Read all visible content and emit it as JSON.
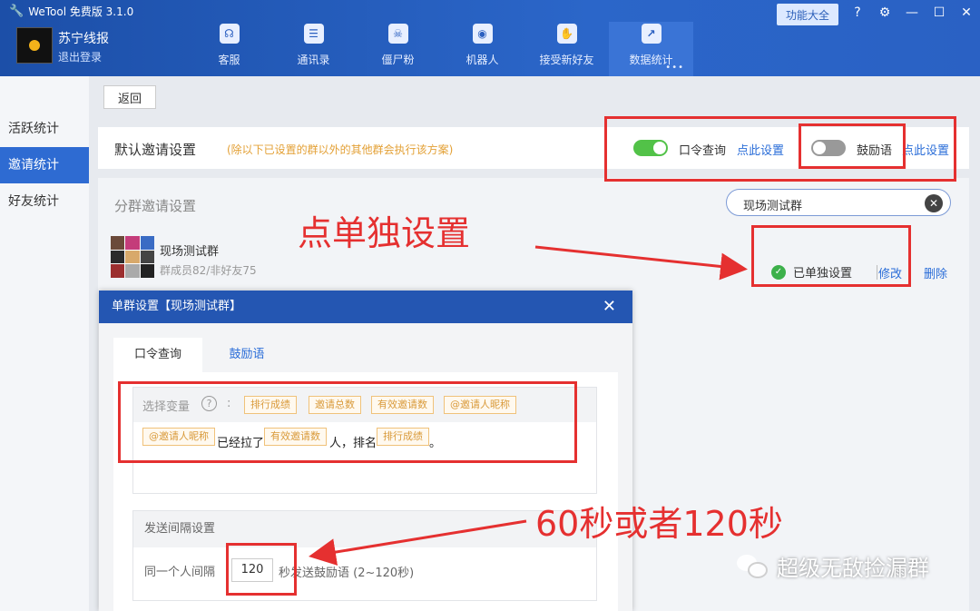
{
  "app": {
    "title": "WeTool 免费版 3.1.0",
    "account_name": "苏宁线报",
    "logout": "退出登录",
    "func_button": "功能大全"
  },
  "nav": [
    {
      "label": "客服",
      "icon": "headset-icon"
    },
    {
      "label": "通讯录",
      "icon": "contacts-icon"
    },
    {
      "label": "僵尸粉",
      "icon": "skull-icon"
    },
    {
      "label": "机器人",
      "icon": "robot-icon"
    },
    {
      "label": "接受新好友",
      "icon": "handshake-icon"
    },
    {
      "label": "数据统计",
      "icon": "chart-icon",
      "active": true
    }
  ],
  "sidebar": {
    "items": [
      {
        "label": "活跃统计"
      },
      {
        "label": "邀请统计",
        "active": true
      },
      {
        "label": "好友统计"
      }
    ]
  },
  "main": {
    "back": "返回",
    "default_panel": {
      "title": "默认邀请设置",
      "hint": "(除以下已设置的群以外的其他群会执行该方案)",
      "toggle1_label": "口令查询",
      "toggle1_state": "on",
      "link1": "点此设置",
      "toggle2_label": "鼓励语",
      "toggle2_state": "off",
      "link2": "点此设置"
    },
    "group_panel": {
      "title": "分群邀请设置",
      "search_value": "现场测试群",
      "group_name": "现场测试群",
      "group_meta": "群成员82/非好友75",
      "status": "已单独设置",
      "edit": "修改",
      "delete": "删除"
    }
  },
  "dialog": {
    "title": "单群设置【现场测试群】",
    "tabs": [
      "口令查询",
      "鼓励语"
    ],
    "var_label": "选择变量",
    "colon": ":",
    "var_tags": [
      "排行成绩",
      "邀请总数",
      "有效邀请数",
      "@邀请人昵称"
    ],
    "message": {
      "tag1": "@邀请人昵称",
      "text1": "已经拉了",
      "tag2": "有效邀请数",
      "text2": "人，排名",
      "tag3": "排行成绩",
      "text3": "。"
    },
    "interval_title": "发送间隔设置",
    "interval_prefix": "同一个人间隔",
    "interval_value": "120",
    "interval_suffix": "秒发送鼓励语 (2~120秒)"
  },
  "annotations": {
    "text1": "点单独设置",
    "text2": "60秒或者120秒",
    "color": "#e53030"
  },
  "watermark": "超级无敌捡漏群",
  "colors": {
    "header": "#2b66c9",
    "accent": "#2e6bd2",
    "toggle_on": "#52c248",
    "hint": "#e3a035",
    "annotation": "#e53030"
  }
}
